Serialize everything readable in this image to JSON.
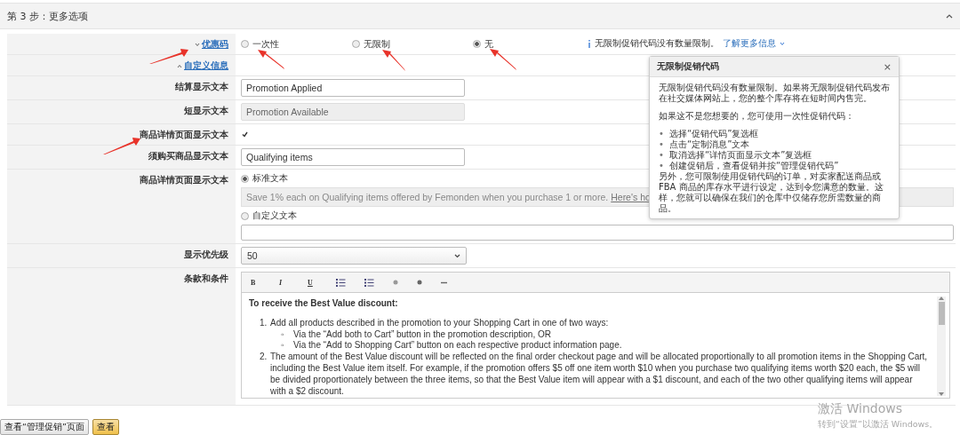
{
  "header": {
    "title": "第 3 步：更多选项"
  },
  "coupon": {
    "label": "优惠码",
    "options": [
      {
        "label": "一次性",
        "selected": false
      },
      {
        "label": "无限制",
        "selected": false
      },
      {
        "label": "无",
        "selected": true
      }
    ],
    "info": "无限制促销代码没有数量限制。",
    "info_link": "了解更多信息"
  },
  "custom_section": {
    "label": "自定义信息"
  },
  "fields": [
    {
      "kind": "text",
      "label": "结算显示文本",
      "value": "Promotion Applied",
      "disabled": false
    },
    {
      "kind": "text",
      "label": "短显示文本",
      "value": "Promotion Available",
      "disabled": true
    },
    {
      "kind": "checkbox",
      "label": "商品详情页面显示文本",
      "checked": true
    },
    {
      "kind": "text",
      "label": "须购买商品显示文本",
      "value": "Qualifying items",
      "disabled": false
    }
  ],
  "detail_text": {
    "label": "商品详情页面显示文本",
    "options": [
      {
        "label": "标准文本",
        "selected": true
      },
      {
        "label": "自定义文本",
        "selected": false
      }
    ],
    "standard_text": "Save 1% each on Qualifying items offered by Femonden when you purchase 1 or more.",
    "standard_link": "Here's ho"
  },
  "priority": {
    "label": "显示优先级",
    "value": "50"
  },
  "terms": {
    "label": "条款和条件",
    "toolbar": [
      "B",
      "I",
      "U"
    ],
    "heading": "To receive the Best Value discount:",
    "items": [
      {
        "number": "1.",
        "text": "Add all products described in the promotion to your Shopping Cart in one of two ways:",
        "subitems": [
          {
            "bullet": "◦",
            "text": "Via the  “Add both to Cart”  button in the promotion description, OR"
          },
          {
            "bullet": "◦",
            "text": "Via the  “Add to Shopping Cart”  button on each respective product information page."
          }
        ]
      },
      {
        "number": "2.",
        "text": "The amount of the Best Value discount will be reflected on the final order checkout page and will be allocated proportionally to all promotion items in the Shopping Cart, including the Best Value item itself. For example, if the promotion offers $5 off one item worth $10 when you purchase two qualifying items worth $20 each, the $5 will be divided proportionately between the three items, so that the Best Value item will appear with a $1 discount, and each of the two other qualifying items will appear with a $2 discount."
      }
    ]
  },
  "popover": {
    "title": "无限制促销代码",
    "close": "×",
    "intro": "无限制促销代码没有数量限制。如果将无限制促销代码发布在社交媒体网站上，您的整个库存将在短时间内售完。",
    "lead": "如果这不是您想要的，您可使用一次性促销代码：",
    "steps": [
      {
        "bullet": "•",
        "text": "选择“促销代码”复选框"
      },
      {
        "bullet": "•",
        "text": "点击“定制消息”文本"
      },
      {
        "bullet": "•",
        "text": "取消选择“详情页面显示文本”复选框"
      },
      {
        "bullet": "•",
        "text": "创建促销后，查看促销并按“管理促销代码”"
      }
    ],
    "outro": "另外，您可限制使用促销代码的订单，对卖家配送商品或 FBA 商品的库存水平进行设定，达到令您满意的数量。这样，您就可以确保在我们的仓库中仅储存您所需数量的商品。"
  },
  "footer": {
    "buttons": [
      {
        "label": "查看“管理促销”页面",
        "primary": false
      },
      {
        "label": "查看",
        "primary": true
      }
    ]
  },
  "os_notice": {
    "title": "激活 Windows",
    "text": "转到“设置”以激活 Windows。"
  }
}
